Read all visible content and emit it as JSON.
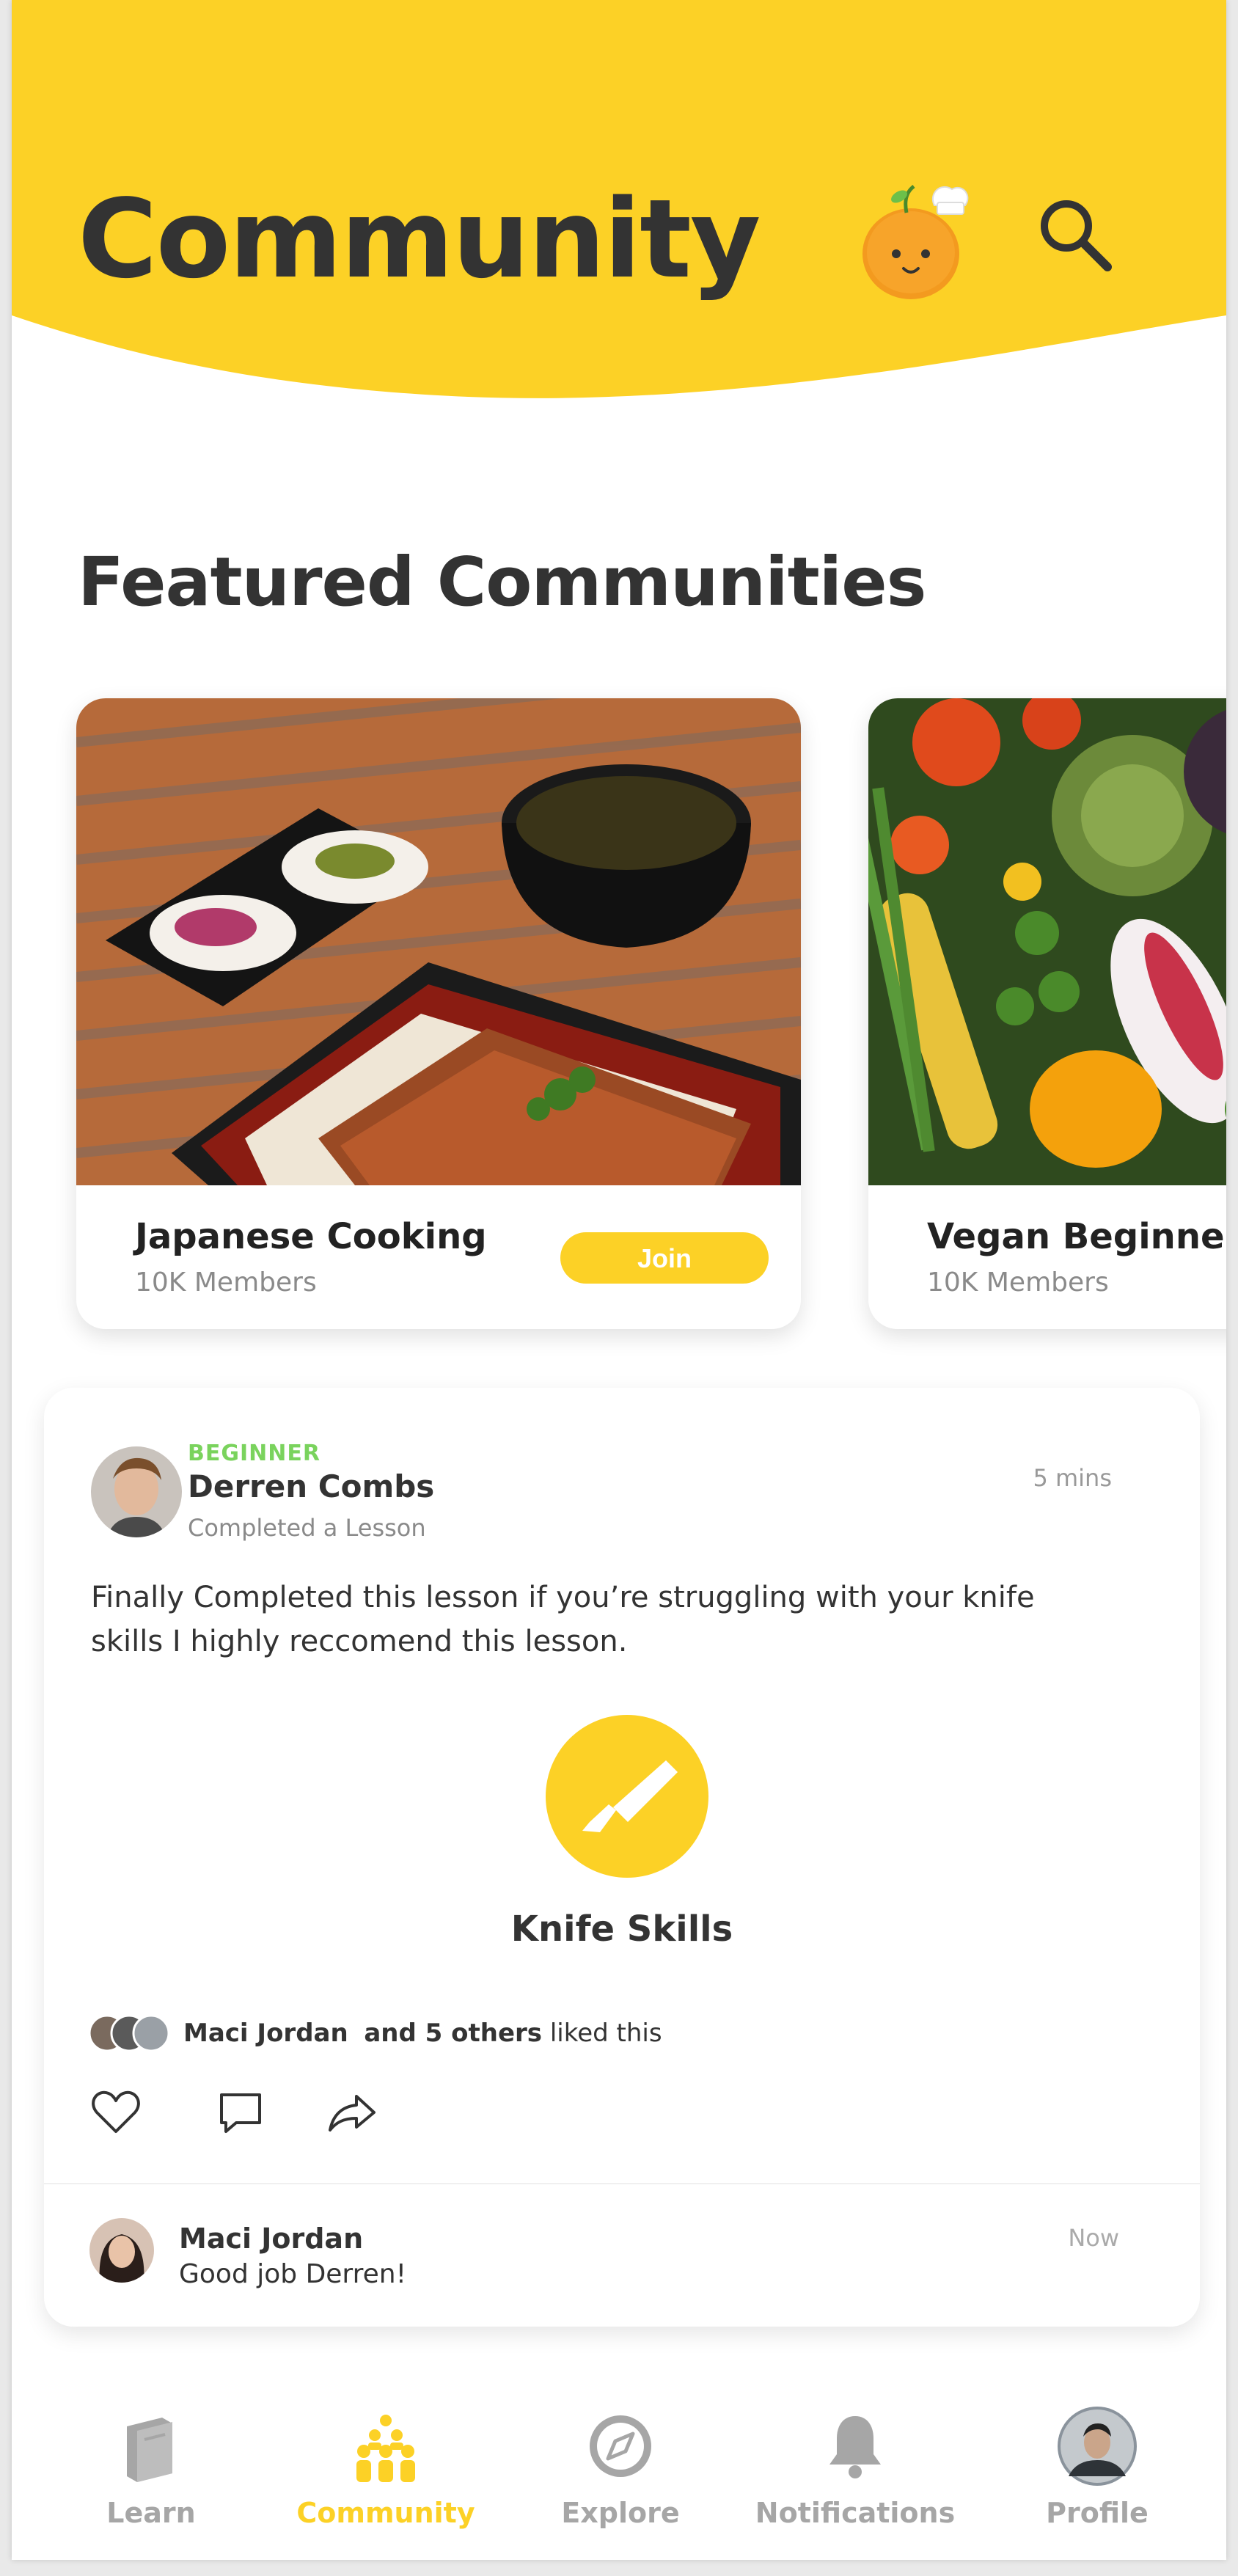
{
  "header": {
    "title": "Community"
  },
  "featured": {
    "title": "Featured Communities",
    "cards": [
      {
        "name": "Japanese Cooking",
        "members": "10K Members",
        "join_label": "Join"
      },
      {
        "name": "Vegan Beginners",
        "members": "10K Members"
      }
    ]
  },
  "post": {
    "level": "BEGINNER",
    "author": "Derren Combs",
    "activity": "Completed a Lesson",
    "time": "5 mins",
    "text": "Finally Completed this lesson if you’re struggling with your knife skills I highly reccomend this lesson.",
    "lesson": "Knife Skills",
    "likes": {
      "name": "Maci Jordan",
      "others": "and 5 others",
      "suffix": "liked this"
    },
    "comment": {
      "author": "Maci Jordan",
      "text": "Good job Derren!",
      "time": "Now"
    }
  },
  "nav": {
    "items": [
      {
        "label": "Learn",
        "icon": "book-icon"
      },
      {
        "label": "Community",
        "icon": "community-icon"
      },
      {
        "label": "Explore",
        "icon": "compass-icon"
      },
      {
        "label": "Notifications",
        "icon": "bell-icon"
      },
      {
        "label": "Profile",
        "icon": "avatar"
      }
    ],
    "active": "Community"
  },
  "colors": {
    "accent": "#FCD126",
    "beginner": "#7AD35D",
    "text": "#333333",
    "muted": "#A6A6A6"
  }
}
